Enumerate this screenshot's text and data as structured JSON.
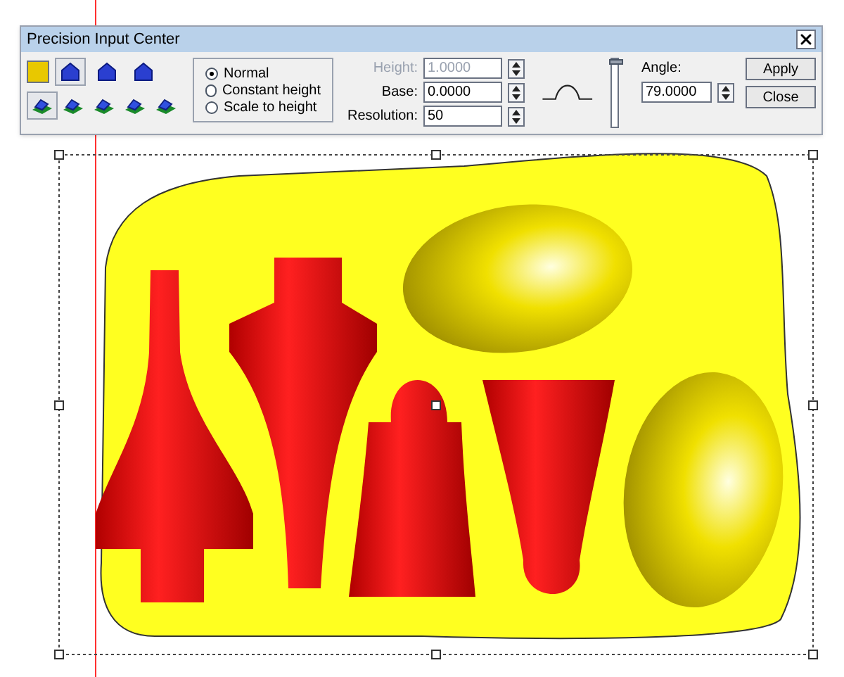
{
  "window": {
    "title": "Precision Input Center"
  },
  "top_tools": [
    {
      "selected": true
    },
    {
      "selected": false
    },
    {
      "selected": false
    }
  ],
  "bottom_tools": [
    {
      "selected": true
    },
    {
      "selected": false
    },
    {
      "selected": false
    },
    {
      "selected": false
    },
    {
      "selected": false
    }
  ],
  "modes": [
    {
      "label": "Normal",
      "selected": true
    },
    {
      "label": "Constant height",
      "selected": false
    },
    {
      "label": "Scale to height",
      "selected": false
    }
  ],
  "fields": [
    {
      "label": "Height:",
      "value": "1.0000",
      "disabled": true
    },
    {
      "label": "Base:",
      "value": "0.0000",
      "disabled": false
    },
    {
      "label": "Resolution:",
      "value": "50",
      "disabled": false
    }
  ],
  "slider": {
    "level": 1
  },
  "angle": {
    "label": "Angle:",
    "value": "79.0000"
  },
  "buttons": [
    "Apply",
    "Close"
  ]
}
